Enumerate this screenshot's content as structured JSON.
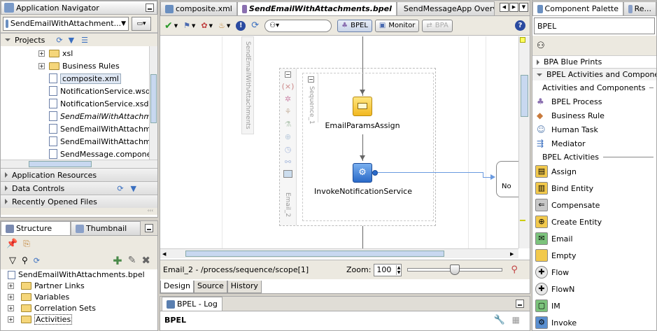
{
  "navigator": {
    "title": "Application Navigator",
    "app_selector": "SendEmailWithAttachment...",
    "projects_label": "Projects",
    "files": [
      {
        "name": "xsl",
        "type": "folder",
        "expand": "+"
      },
      {
        "name": "Business Rules",
        "type": "folder",
        "expand": "+"
      },
      {
        "name": "composite.xml",
        "type": "file",
        "selected": true
      },
      {
        "name": "NotificationService.wsdl",
        "type": "file"
      },
      {
        "name": "NotificationService.xsd",
        "type": "file"
      },
      {
        "name": "SendEmailWithAttachmen",
        "type": "file",
        "italic": true
      },
      {
        "name": "SendEmailWithAttachmen",
        "type": "file"
      },
      {
        "name": "SendEmailWithAttachmen",
        "type": "file"
      },
      {
        "name": "SendMessage.componen",
        "type": "file"
      }
    ],
    "sections": [
      "Application Resources",
      "Data Controls",
      "Recently Opened Files"
    ]
  },
  "structure": {
    "tab_structure": "Structure",
    "tab_thumbnail": "Thumbnail",
    "root": "SendEmailWithAttachments.bpel",
    "items": [
      "Partner Links",
      "Variables",
      "Correlation Sets",
      "Activities"
    ]
  },
  "editor": {
    "tabs": [
      "composite.xml",
      "SendEmailWithAttachments.bpel",
      "SendMessageApp Overv"
    ],
    "toolbar": {
      "bpel": "BPEL",
      "monitor": "Monitor",
      "bpa": "BPA"
    },
    "scope_label": "SendEmailWithAttachments",
    "sequence_label": "Sequence_1",
    "email_label": "Email_2",
    "activity1": "EmailParamsAssign",
    "activity2": "InvokeNotificationService",
    "partner_partial": "No",
    "status_path": "Email_2 - /process/sequence/scope[1]",
    "zoom_label": "Zoom:",
    "zoom_value": "100",
    "bottom_tabs": [
      "Design",
      "Source",
      "History"
    ]
  },
  "log": {
    "title": "BPEL - Log",
    "content": "BPEL"
  },
  "palette": {
    "tab1": "Component Palette",
    "tab2": "Re...",
    "selector": "BPEL",
    "groups": [
      "BPA Blue Prints",
      "BPEL Activities and Components"
    ],
    "subsection1": "Activities and Components",
    "components": [
      {
        "name": "BPEL Process",
        "color": "#8a6fb0"
      },
      {
        "name": "Business Rule",
        "color": "#c87a3c"
      },
      {
        "name": "Human Task",
        "color": "#5a7fb0"
      },
      {
        "name": "Mediator",
        "color": "#3a6fc0"
      }
    ],
    "subsection2": "BPEL Activities",
    "activities": [
      {
        "name": "Assign",
        "color": "#f2c94c"
      },
      {
        "name": "Bind Entity",
        "color": "#f2c94c"
      },
      {
        "name": "Compensate",
        "color": "#c8c8c8"
      },
      {
        "name": "Create Entity",
        "color": "#f2c94c"
      },
      {
        "name": "Email",
        "color": "#7cc37c"
      },
      {
        "name": "Empty",
        "color": "#f2c94c"
      },
      {
        "name": "Flow",
        "color": "#e8e8e8"
      },
      {
        "name": "FlowN",
        "color": "#e8e8e8"
      },
      {
        "name": "IM",
        "color": "#7cc37c"
      },
      {
        "name": "Invoke",
        "color": "#5a8fd0"
      }
    ]
  }
}
